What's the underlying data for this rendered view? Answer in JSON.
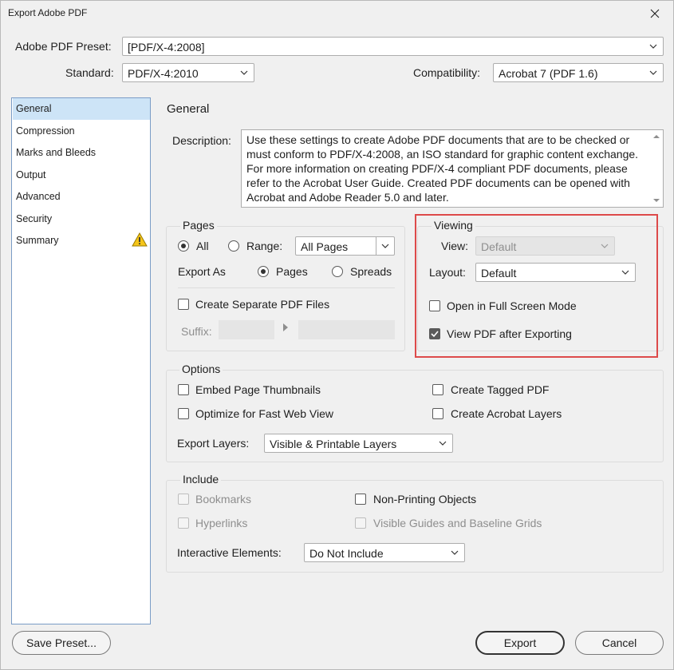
{
  "window": {
    "title": "Export Adobe PDF"
  },
  "header": {
    "preset_label": "Adobe PDF Preset:",
    "preset_value": "[PDF/X-4:2008]",
    "standard_label": "Standard:",
    "standard_value": "PDF/X-4:2010",
    "compat_label": "Compatibility:",
    "compat_value": "Acrobat 7 (PDF 1.6)"
  },
  "sidebar": {
    "items": [
      {
        "label": "General"
      },
      {
        "label": "Compression"
      },
      {
        "label": "Marks and Bleeds"
      },
      {
        "label": "Output"
      },
      {
        "label": "Advanced"
      },
      {
        "label": "Security"
      },
      {
        "label": "Summary"
      }
    ],
    "selected": "General"
  },
  "general": {
    "title": "General",
    "description_label": "Description:",
    "description": "Use these settings to create Adobe PDF documents that are to be checked or must conform to PDF/X-4:2008, an ISO standard for graphic content exchange.  For more information on creating PDF/X-4 compliant PDF documents, please refer to the Acrobat User Guide.  Created PDF documents can be opened with Acrobat and Adobe Reader 5.0 and later."
  },
  "pages": {
    "title": "Pages",
    "all_label": "All",
    "range_label": "Range:",
    "range_value": "All Pages",
    "export_as_label": "Export As",
    "pages_label": "Pages",
    "spreads_label": "Spreads",
    "separate_label": "Create Separate PDF Files",
    "suffix_label": "Suffix:"
  },
  "viewing": {
    "title": "Viewing",
    "view_label": "View:",
    "view_value": "Default",
    "layout_label": "Layout:",
    "layout_value": "Default",
    "fullscreen_label": "Open in Full Screen Mode",
    "view_after_label": "View PDF after Exporting"
  },
  "options": {
    "title": "Options",
    "embed_thumbs": "Embed Page Thumbnails",
    "optimize_web": "Optimize for Fast Web View",
    "tagged_pdf": "Create Tagged PDF",
    "acrobat_layers": "Create Acrobat Layers",
    "export_layers_label": "Export Layers:",
    "export_layers_value": "Visible & Printable Layers"
  },
  "include": {
    "title": "Include",
    "bookmarks": "Bookmarks",
    "hyperlinks": "Hyperlinks",
    "non_printing": "Non-Printing Objects",
    "guides": "Visible Guides and Baseline Grids",
    "interactive_label": "Interactive Elements:",
    "interactive_value": "Do Not Include"
  },
  "footer": {
    "save_preset": "Save Preset...",
    "export": "Export",
    "cancel": "Cancel"
  },
  "colors": {
    "selection": "#cde4f7",
    "highlight_box": "#dd4a4a",
    "warning": "#f5c518"
  }
}
